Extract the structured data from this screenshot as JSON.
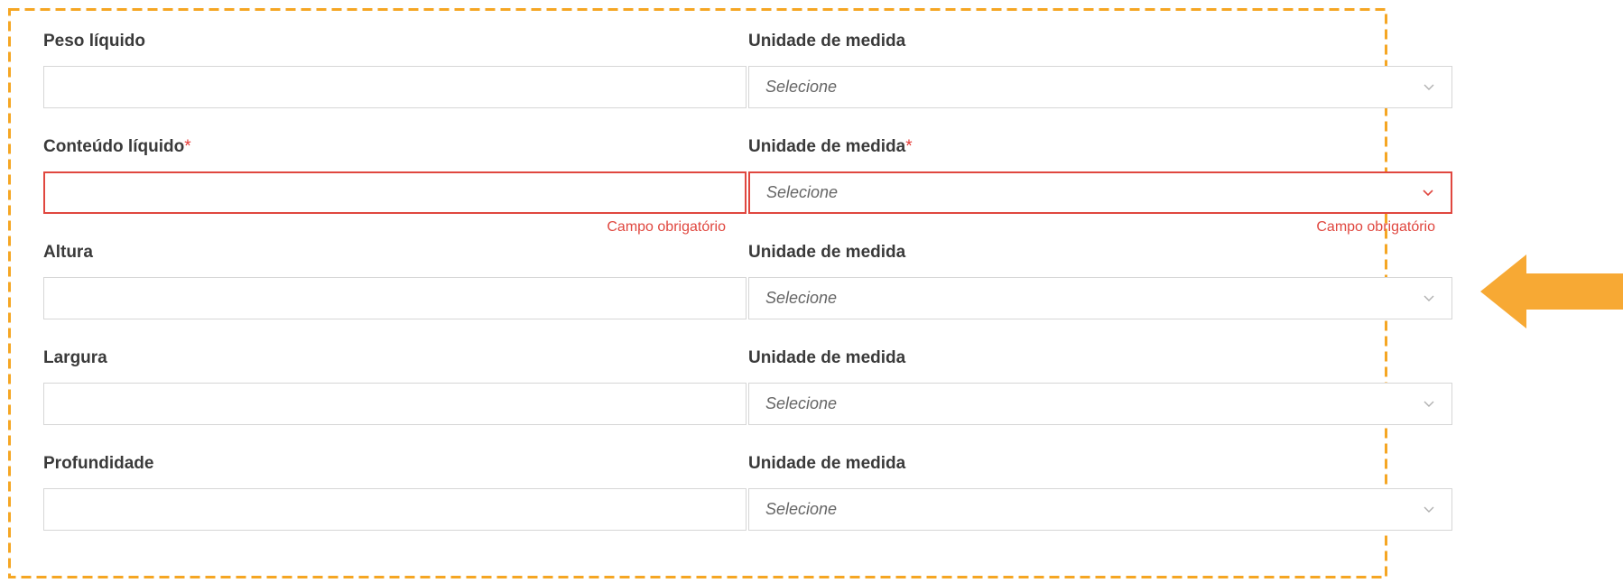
{
  "colors": {
    "highlight": "#f5a623",
    "error": "#e0473f",
    "required_asterisk": "#e53935"
  },
  "annotation": {
    "frame_style": "dashed",
    "arrow_icon": "arrow-left-icon"
  },
  "form": {
    "rows": [
      {
        "field_label": "Peso líquido",
        "field_required": false,
        "field_value": "",
        "unit_label": "Unidade de medida",
        "unit_required": false,
        "unit_value": "Selecione",
        "error": false
      },
      {
        "field_label": "Conteúdo líquido",
        "field_required": true,
        "field_value": "",
        "unit_label": "Unidade de medida",
        "unit_required": true,
        "unit_value": "Selecione",
        "error": true,
        "field_error": "Campo obrigatório",
        "unit_error": "Campo obrigatório"
      },
      {
        "field_label": "Altura",
        "field_required": false,
        "field_value": "",
        "unit_label": "Unidade de medida",
        "unit_required": false,
        "unit_value": "Selecione",
        "error": false
      },
      {
        "field_label": "Largura",
        "field_required": false,
        "field_value": "",
        "unit_label": "Unidade de medida",
        "unit_required": false,
        "unit_value": "Selecione",
        "error": false
      },
      {
        "field_label": "Profundidade",
        "field_required": false,
        "field_value": "",
        "unit_label": "Unidade de medida",
        "unit_required": false,
        "unit_value": "Selecione",
        "error": false
      }
    ],
    "required_marker": "*"
  }
}
